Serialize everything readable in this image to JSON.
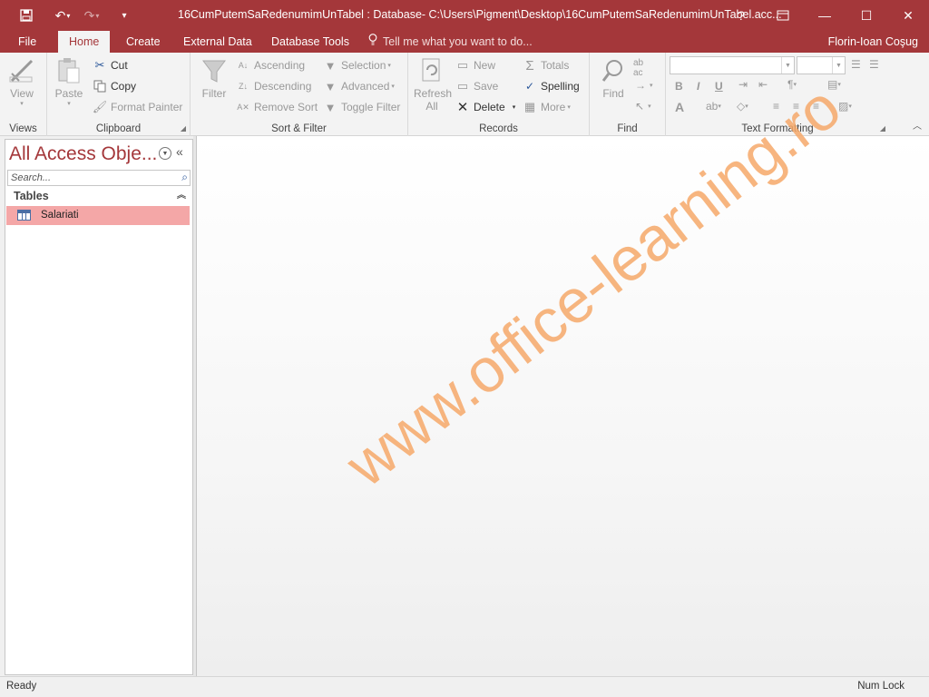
{
  "window": {
    "title": "16CumPutemSaRedenumimUnTabel : Database- C:\\Users\\Pigment\\Desktop\\16CumPutemSaRedenumimUnTabel.acc...",
    "help": "?",
    "minimize": "—",
    "maximize": "☐",
    "close": "✕"
  },
  "qat": {
    "save": "💾",
    "undo": "↶",
    "redo": "↷",
    "customize": "▾"
  },
  "tabs": {
    "file": "File",
    "home": "Home",
    "create": "Create",
    "external": "External Data",
    "dbtools": "Database Tools",
    "tellme": "Tell me what you want to do...",
    "user": "Florin-Ioan Coşug"
  },
  "ribbon": {
    "views": {
      "label": "Views",
      "view": "View"
    },
    "clipboard": {
      "label": "Clipboard",
      "paste": "Paste",
      "cut": "Cut",
      "copy": "Copy",
      "format_painter": "Format Painter"
    },
    "sortfilter": {
      "label": "Sort & Filter",
      "filter": "Filter",
      "ascending": "Ascending",
      "descending": "Descending",
      "remove_sort": "Remove Sort",
      "selection": "Selection",
      "advanced": "Advanced",
      "toggle_filter": "Toggle Filter"
    },
    "records": {
      "label": "Records",
      "refresh": "Refresh All",
      "new": "New",
      "save": "Save",
      "delete": "Delete",
      "totals": "Totals",
      "spelling": "Spelling",
      "more": "More"
    },
    "find": {
      "label": "Find",
      "find": "Find"
    },
    "text": {
      "label": "Text Formatting",
      "bold": "B",
      "italic": "I",
      "underline": "U",
      "font_color": "A"
    }
  },
  "nav": {
    "title": "All Access Obje...",
    "search_placeholder": "Search...",
    "group": "Tables",
    "items": [
      {
        "label": "Salariati"
      }
    ]
  },
  "watermark": "www.office-learning.ro",
  "status": {
    "left": "Ready",
    "right": "Num Lock"
  }
}
